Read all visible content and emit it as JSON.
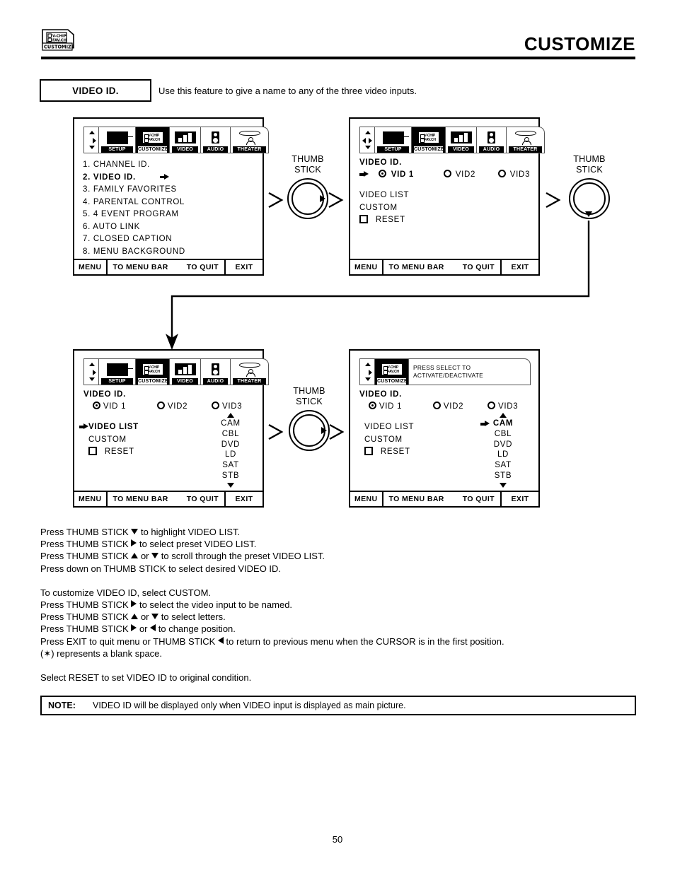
{
  "header": {
    "title": "CUSTOMIZE",
    "chip_icon": {
      "line1": "V-CHIP",
      "line2": "FAV.CH",
      "caption": "CUSTOMIZE"
    }
  },
  "feature": {
    "name": "VIDEO ID.",
    "description": "Use this feature to give a name to any of the three video inputs."
  },
  "menu_tabs": [
    {
      "label": "SETUP",
      "selected": false
    },
    {
      "label": "CUSTOMIZE",
      "selected": true
    },
    {
      "label": "VIDEO",
      "selected": false
    },
    {
      "label": "AUDIO",
      "selected": false
    },
    {
      "label": "THEATER",
      "selected": false
    }
  ],
  "footer": {
    "menu": "MENU",
    "to_menu_bar": "TO MENU BAR",
    "to_quit": "TO QUIT",
    "exit": "EXIT"
  },
  "panel1": {
    "items": [
      "1. CHANNEL ID.",
      "2. VIDEO ID.",
      "3. FAMILY FAVORITES",
      "4. PARENTAL CONTROL",
      "5. 4 EVENT PROGRAM",
      "6. AUTO LINK",
      "7. CLOSED CAPTION",
      "8. MENU BACKGROUND"
    ],
    "selected_index": 1
  },
  "panel2": {
    "title": "VIDEO ID.",
    "inputs": [
      {
        "label": "VID 1",
        "checked": true
      },
      {
        "label": "VID2",
        "checked": false
      },
      {
        "label": "VID3",
        "checked": false
      }
    ],
    "options": [
      "VIDEO LIST",
      "CUSTOM"
    ],
    "reset_label": "RESET"
  },
  "panel3": {
    "title": "VIDEO ID.",
    "inputs": [
      {
        "label": "VID 1",
        "checked": true
      },
      {
        "label": "VID2",
        "checked": false
      },
      {
        "label": "VID3",
        "checked": false
      }
    ],
    "options": [
      "VIDEO  LIST",
      "CUSTOM"
    ],
    "reset_label": "RESET",
    "video_list": [
      "CAM",
      "CBL",
      "DVD",
      "LD",
      "SAT",
      "STB"
    ],
    "cursor_on": "VIDEO  LIST"
  },
  "panel4": {
    "banner": {
      "line1": "PRESS SELECT TO",
      "line2": "ACTIVATE/DEACTIVATE"
    },
    "title": "VIDEO ID.",
    "inputs": [
      {
        "label": "VID 1",
        "checked": true
      },
      {
        "label": "VID2",
        "checked": false
      },
      {
        "label": "VID3",
        "checked": false
      }
    ],
    "options": [
      "VIDEO  LIST",
      "CUSTOM"
    ],
    "reset_label": "RESET",
    "video_list": [
      "CAM",
      "CBL",
      "DVD",
      "LD",
      "SAT",
      "STB"
    ],
    "cursor_on": "CAM"
  },
  "thumb_sticks": [
    {
      "line1": "THUMB",
      "line2": "STICK",
      "direction": "right"
    },
    {
      "line1": "THUMB",
      "line2": "STICK",
      "direction": "down"
    },
    {
      "line1": "THUMB",
      "line2": "STICK",
      "direction": "right"
    }
  ],
  "instructions": {
    "group1": [
      {
        "pre": "Press THUMB STICK ",
        "icon": "down",
        "post": " to highlight VIDEO LIST."
      },
      {
        "pre": "Press THUMB STICK ",
        "icon": "right",
        "post": " to select preset VIDEO LIST."
      },
      {
        "pre": "Press THUMB STICK ",
        "icon": "up",
        "mid": " or ",
        "icon2": "down",
        "post": " to scroll through the preset VIDEO LIST."
      },
      {
        "pre": "Press down on THUMB STICK to select desired VIDEO ID.",
        "icon": "",
        "post": ""
      }
    ],
    "group2": [
      {
        "pre": "To customize VIDEO ID, select CUSTOM.",
        "icon": "",
        "post": ""
      },
      {
        "pre": "Press THUMB STICK ",
        "icon": "right",
        "post": " to select the video input to be named."
      },
      {
        "pre": "Press THUMB STICK ",
        "icon": "up",
        "mid": " or ",
        "icon2": "down",
        "post": " to select letters."
      },
      {
        "pre": "Press THUMB STICK ",
        "icon": "right",
        "mid": " or ",
        "icon2": "left",
        "post": " to change position."
      },
      {
        "pre": "Press EXIT to quit menu or THUMB STICK ",
        "icon": "left",
        "post": " to return to previous menu when the CURSOR is in the first position."
      },
      {
        "pre": "(✶) represents a blank space.",
        "icon": "",
        "post": ""
      }
    ],
    "group3": [
      {
        "pre": "Select RESET to set VIDEO ID to original condition.",
        "icon": "",
        "post": ""
      }
    ]
  },
  "note": {
    "label": "NOTE:",
    "text": "VIDEO ID will be displayed only when VIDEO input is displayed as main picture."
  },
  "page_number": "50"
}
